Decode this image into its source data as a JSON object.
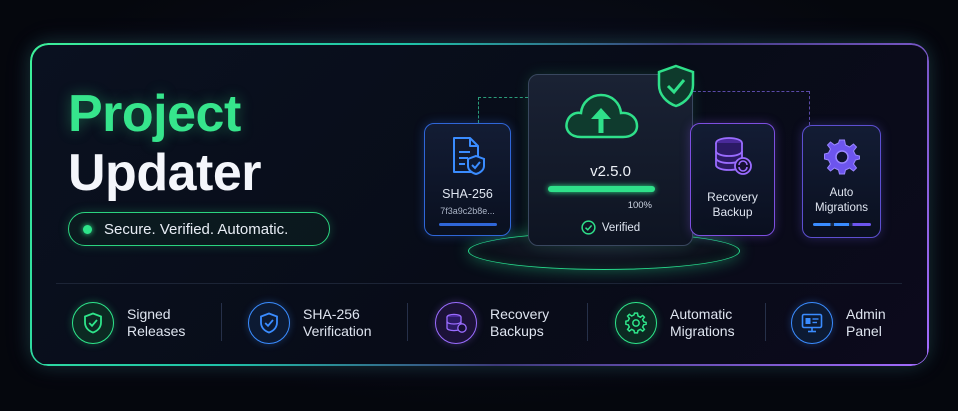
{
  "hero": {
    "title_line1": "Project",
    "title_line2": "Updater",
    "tagline": "Secure. Verified. Automatic."
  },
  "illustration": {
    "hash_card": {
      "icon": "file-shield-icon",
      "label": "SHA-256",
      "hash": "7f3a9c2b8e..."
    },
    "main_card": {
      "icon": "cloud-upload-icon",
      "badge_icon": "shield-check-icon",
      "version": "v2.5.0",
      "progress_percent_label": "100%",
      "progress_fraction": 1.0,
      "status_icon": "check-circle-icon",
      "status": "Verified"
    },
    "backup_card": {
      "icon": "database-refresh-icon",
      "label_line1": "Recovery",
      "label_line2": "Backup"
    },
    "migrations_card": {
      "icon": "gear-icon",
      "label_line1": "Auto",
      "label_line2": "Migrations"
    }
  },
  "features": [
    {
      "icon": "shield-check-icon",
      "line1": "Signed",
      "line2": "Releases",
      "color": "#2ee58a"
    },
    {
      "icon": "shield-check-icon",
      "line1": "SHA-256",
      "line2": "Verification",
      "color": "#3a8cff"
    },
    {
      "icon": "database-refresh-icon",
      "line1": "Recovery",
      "line2": "Backups",
      "color": "#9a6cff"
    },
    {
      "icon": "gear-icon",
      "line1": "Automatic",
      "line2": "Migrations",
      "color": "#2ee58a"
    },
    {
      "icon": "monitor-panel-icon",
      "line1": "Admin",
      "line2": "Panel",
      "color": "#3a8cff"
    }
  ],
  "colors": {
    "accent_green": "#36e58c",
    "accent_blue": "#2f66d8",
    "accent_purple": "#7d4fe0",
    "background": "#05070d"
  }
}
